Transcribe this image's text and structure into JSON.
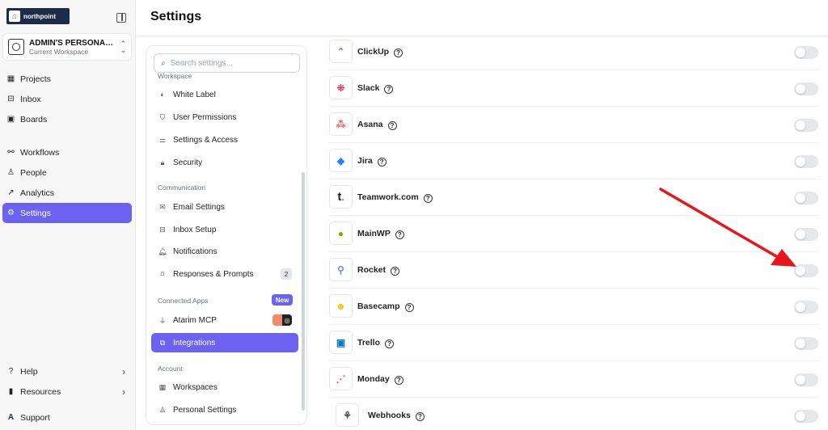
{
  "brand": {
    "logo_text": "northpoint"
  },
  "workspace": {
    "name": "ADMIN'S PERSONAL ...",
    "subtitle": "Current Workspace"
  },
  "sidebar": {
    "items": [
      {
        "label": "Projects",
        "icon": "grid-icon"
      },
      {
        "label": "Inbox",
        "icon": "inbox-icon"
      },
      {
        "label": "Boards",
        "icon": "board-icon"
      },
      {
        "label": "Workflows",
        "icon": "workflow-icon"
      },
      {
        "label": "People",
        "icon": "person-icon"
      },
      {
        "label": "Analytics",
        "icon": "chart-icon"
      },
      {
        "label": "Settings",
        "icon": "gear-icon",
        "active": true
      }
    ],
    "bottom": [
      {
        "label": "Help",
        "icon": "help-icon"
      },
      {
        "label": "Resources",
        "icon": "bars-icon"
      },
      {
        "label": "Support",
        "icon": "support-icon"
      }
    ]
  },
  "header": {
    "title": "Settings"
  },
  "settings_nav": {
    "search_placeholder": "Search settings...",
    "sections": [
      {
        "title": "Workspace",
        "items": [
          "White Label",
          "User Permissions",
          "Settings & Access",
          "Security"
        ]
      },
      {
        "title": "Communication",
        "items": [
          "Email Settings",
          "Inbox Setup",
          "Notifications",
          "Responses & Prompts"
        ],
        "responses_count": "2"
      },
      {
        "title": "Connected Apps",
        "badge": "New",
        "items": [
          "Atarim MCP",
          "Integrations"
        ],
        "active": "Integrations"
      },
      {
        "title": "Account",
        "items": [
          "Workspaces",
          "Personal Settings"
        ]
      }
    ]
  },
  "integrations": [
    {
      "name": "ClickUp",
      "enabled": false
    },
    {
      "name": "Slack",
      "enabled": false
    },
    {
      "name": "Asana",
      "enabled": false
    },
    {
      "name": "Jira",
      "enabled": false
    },
    {
      "name": "Teamwork.com",
      "enabled": false
    },
    {
      "name": "MainWP",
      "enabled": false
    },
    {
      "name": "Rocket",
      "enabled": false
    },
    {
      "name": "Basecamp",
      "enabled": false
    },
    {
      "name": "Trello",
      "enabled": false
    },
    {
      "name": "Monday",
      "enabled": false
    },
    {
      "name": "Webhooks",
      "enabled": false
    }
  ],
  "colors": {
    "accent": "#6b62f2",
    "arrow": "#e8161b"
  }
}
